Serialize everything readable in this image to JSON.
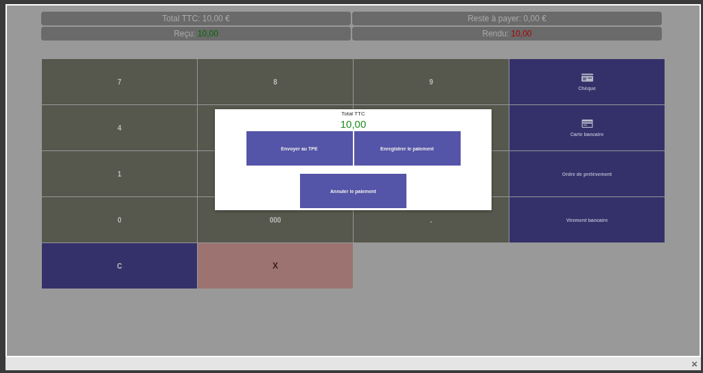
{
  "summary": [
    {
      "label": "Total TTC: 10,00 €"
    },
    {
      "label": "Reste à payer: 0,00 €"
    },
    {
      "label": "Reçu: ",
      "value": "10,00",
      "color": "#006600"
    },
    {
      "label": "Rendu: ",
      "value": "10,00",
      "color": "#aa0000"
    }
  ],
  "keypad": [
    {
      "kind": "digit",
      "label": "7"
    },
    {
      "kind": "digit",
      "label": "8"
    },
    {
      "kind": "digit",
      "label": "9"
    },
    {
      "kind": "cheque",
      "label": "Chèque"
    },
    {
      "kind": "digit",
      "label": "4"
    },
    {
      "kind": "digit"
    },
    {
      "kind": "digit"
    },
    {
      "kind": "card",
      "label": "Carte bancaire"
    },
    {
      "kind": "digit",
      "label": "1"
    },
    {
      "kind": "digit"
    },
    {
      "kind": "digit"
    },
    {
      "kind": "payment",
      "label": "Ordre de prélèvement"
    },
    {
      "kind": "digit",
      "label": "0"
    },
    {
      "kind": "digit",
      "label": "000"
    },
    {
      "kind": "digit",
      "label": "."
    },
    {
      "kind": "payment",
      "label": "Virement bancaire"
    },
    {
      "kind": "clear",
      "label": "C"
    },
    {
      "kind": "cancel",
      "label": "X"
    }
  ],
  "modal": {
    "title": "Total TTC",
    "amount": "10,00",
    "buttons": [
      "Envoyer au TPE",
      "Enregistrer le paiement"
    ],
    "cancel": "Annuler le paiement"
  },
  "bottom_bar": {
    "close": "×"
  }
}
